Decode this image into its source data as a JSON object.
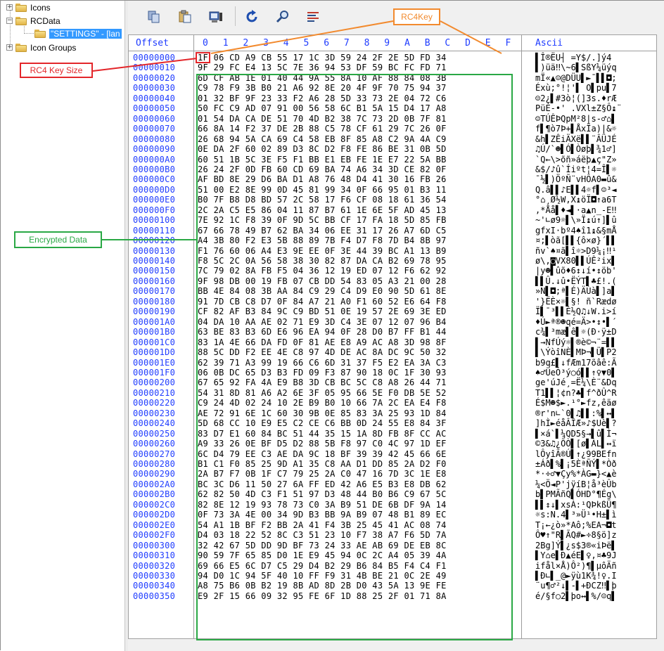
{
  "tree": {
    "items": [
      {
        "label": "Icons",
        "expander": "+"
      },
      {
        "label": "RCData",
        "expander": "−"
      },
      {
        "label": "\"SETTINGS\" - [lan"
      },
      {
        "label": "Icon Groups",
        "expander": "+"
      }
    ]
  },
  "toolbar": {
    "buttons": [
      "copy-icon",
      "paste-icon",
      "view-icon",
      "redo-icon",
      "find-icon",
      "hex-settings-icon"
    ]
  },
  "hex": {
    "offset_header": "Offset",
    "column_headers": [
      "0",
      "1",
      "2",
      "3",
      "4",
      "5",
      "6",
      "7",
      "8",
      "9",
      "A",
      "B",
      "C",
      "D",
      "E",
      "F"
    ],
    "ascii_header": "Ascii",
    "rows": [
      {
        "offset": "00000000",
        "bytes": "1F 06 CD A9 CB 55 17 1C 3D 59 24 2F 2E 5D FD 34",
        "ascii": "▌Î®ËU┤ =Y$/.]ý4"
      },
      {
        "offset": "00000010",
        "bytes": "9F 29 FC E4 13 5C 7E 36 94 53 DF 59 BC FC FD 71",
        "ascii": "▌)üä‼\\~6▌SßY¼üýq"
      },
      {
        "offset": "00000020",
        "bytes": "6D CF AB 1E 01 40 44 9A 55 8A 10 AF 88 84 08 3B",
        "ascii": "mÏ«▲☺@DÜU▌►¯▌▌◘;"
      },
      {
        "offset": "00000030",
        "bytes": "C9 78 F9 3B B0 21 A6 92 8E 20 4F 9F 70 75 94 37",
        "ascii": "Éxù;°!¦'▌ O▌pu▌7"
      },
      {
        "offset": "00000040",
        "bytes": "01 32 BF 9F 23 33 F2 A6 28 5D 33 73 2E 04 72 C6",
        "ascii": "☺2¿▌#3ò¦(]3s.♦rÆ"
      },
      {
        "offset": "00000050",
        "bytes": "50 FC C9 AD 07 91 00 56 58 6C B1 5A 15 D4 17 A8",
        "ascii": "PüÉ-•' .VXl±Z§Ô↨¨"
      },
      {
        "offset": "00000060",
        "bytes": "01 54 DA CA DE 51 70 4D B2 38 7C 73 2D 0B 7F 81",
        "ascii": "☺TÚÊÞQpM²8|s-♂⌂▌"
      },
      {
        "offset": "00000070",
        "bytes": "66 8A 14 F2 37 DE 2B 88 C5 78 CF 61 29 7C 26 0F",
        "ascii": "f▌¶ò7Þ+▌ÅxÏa)|&☼"
      },
      {
        "offset": "00000080",
        "bytes": "26 68 94 5A CA 69 C4 58 EB 8F 85 A8 C2 9A 4A C9",
        "ascii": "&h▌ZÊiÄXë▌▌¨ÂÜJÉ"
      },
      {
        "offset": "00000090",
        "bytes": "0E DA 2F 60 02 89 D3 8C D2 F8 FE 86 BE 31 0B 5D",
        "ascii": "♫Ú/`☻▌Ó▌Òøþ▌¾1♂]"
      },
      {
        "offset": "000000A0",
        "bytes": "60 51 1B 5C 3E F5 F1 BB E1 EB FE 1E E7 22 5A BB",
        "ascii": "`Q←\\>õñ»áëþ▲ç\"Z»"
      },
      {
        "offset": "000000B0",
        "bytes": "26 24 2F 0D FB 60 CD 69 BA 74 A6 34 3D CE 82 0F",
        "ascii": "&$/♪û`Íiºt¦4=Î▌☼"
      },
      {
        "offset": "000000C0",
        "bytes": "AF BD 8E 29 D6 BA D1 A8 76 48 D4 41 30 16 FB 26",
        "ascii": "¯½▌)ÖºÑ¨vHÔA0▬û&"
      },
      {
        "offset": "000000D0",
        "bytes": "51 00 E2 8E 99 0D 45 81 99 34 0F 66 95 01 B3 11",
        "ascii": "Q.â▌▌♪E▌▌4☼f▌☺³◄"
      },
      {
        "offset": "000000E0",
        "bytes": "B0 7F B8 D8 BD 57 2C 58 17 F6 CF 08 18 61 36 54",
        "ascii": "°⌂¸Ø½W,X↨öÏ◘↑a6T"
      },
      {
        "offset": "000000F0",
        "bytes": "2C 2A C5 E5 86 04 11 87 B7 61 1E 6E 5F AD 45 13",
        "ascii": ",*Åå▌♦◄▌·a▲n_-E‼"
      },
      {
        "offset": "00000100",
        "bytes": "7E 92 1C F8 39 0F 9D 5C BB CF 17 FA 18 5D 85 FB",
        "ascii": "~'∟ø9☼▌\\»Ï↨ú↑]▌û"
      },
      {
        "offset": "00000110",
        "bytes": "67 66 78 49 B7 62 BA 34 06 EE 31 17 26 A7 6D C5",
        "ascii": "gfxI·bº4♠î1↨&§mÅ"
      },
      {
        "offset": "00000120",
        "bytes": "A4 3B 80 F2 E3 5B 88 89 7B F4 D7 F8 7D B4 8B 97",
        "ascii": "¤;▌òã[▌▌{ô×ø}´▌▌"
      },
      {
        "offset": "00000130",
        "bytes": "F1 76 60 06 A4 E3 9E EE 0F 3E 44 39 BC A1 13 B9",
        "ascii": "ñv`♠¤ã▌î☼>D9¼¡‼¹"
      },
      {
        "offset": "00000140",
        "bytes": "F8 5C 2C 0A 56 58 38 30 82 87 DA CA B2 69 78 95",
        "ascii": "ø\\,◙VX80▌▌ÚÊ²ix▌"
      },
      {
        "offset": "00000150",
        "bytes": "7C 79 02 8A FB F5 04 36 12 19 ED 07 12 F6 62 92",
        "ascii": "|y☻▌ûõ♦6↕↓í•↕öb'"
      },
      {
        "offset": "00000160",
        "bytes": "9F 98 DB 00 19 FB 07 CB DD 54 83 05 A3 21 00 28",
        "ascii": "▌▌Û.↓û•ËÝT▌♣£!.("
      },
      {
        "offset": "00000170",
        "bytes": "BB 4E 84 08 3B AA 84 C9 29 C4 D9 E0 90 5D 61 8E",
        "ascii": "»N▌◘;ª▌É)ÄÙà▌]a▌"
      },
      {
        "offset": "00000180",
        "bytes": "91 7D CB C8 D7 0F 84 A7 21 A0 F1 60 52 E6 64 F8",
        "ascii": "'}ËÈ×☼▌§! ñ`Rædø"
      },
      {
        "offset": "00000190",
        "bytes": "CF 82 AF B3 84 9C C9 BD 51 0E 19 57 2E 69 3E ED",
        "ascii": "Ï▌¯³▌▌É½Q♫↓W.i>í"
      },
      {
        "offset": "000001A0",
        "bytes": "04 DA 10 AA AE 02 71 E9 3D C4 3E 07 12 07 96 B4",
        "ascii": "♦Ú►ª®☻qé=Ä>•↕•▌´"
      },
      {
        "offset": "000001B0",
        "bytes": "63 BE 83 B3 6D E6 96 EA 94 0F 28 D0 B7 FF B1 44",
        "ascii": "c¾▌³mæ▌ê▌☼(Ð·ÿ±D"
      },
      {
        "offset": "000001C0",
        "bytes": "83 1A 4E 66 DA FD 0F 81 AE E8 A9 AC A8 3D 98 8F",
        "ascii": "▌→NfÚý☼▌®è©¬¨=▌▌"
      },
      {
        "offset": "000001D0",
        "bytes": "88 5C DD F2 EE 4E C8 97 4D DE AC 8A DC 9C 50 32",
        "ascii": "▌\\ÝòîNÈ▌MÞ¬▌Ü▌P2"
      },
      {
        "offset": "000001E0",
        "bytes": "62 39 71 A3 99 19 66 C6 6D 31 37 F5 E2 EA 3A C3",
        "ascii": "b9q£▌↓fÆm17õâê:Ã"
      },
      {
        "offset": "000001F0",
        "bytes": "06 0B DC 65 D3 B3 FD 09 F3 87 90 18 0C 1F 30 93",
        "ascii": "♠♂ÜeÓ³ý○ó▌▌↑♀▼0▌"
      },
      {
        "offset": "00000200",
        "bytes": "67 65 92 FA 4A E9 B8 3D CB BC 5C C8 A8 26 44 71",
        "ascii": "ge'úJé¸=Ë¼\\È¨&Dq"
      },
      {
        "offset": "00000210",
        "bytes": "54 31 8D 81 A6 A2 6E 3F 05 95 66 5E F0 DB 5E 52",
        "ascii": "T1▌▌¦¢n?♣▌f^ðÛ^R"
      },
      {
        "offset": "00000220",
        "bytes": "C9 24 4D 02 24 10 2E B9 B0 10 66 7A 2C EA E4 F8",
        "ascii": "É$M☻$►.¹°►fz,êäø"
      },
      {
        "offset": "00000230",
        "bytes": "AE 72 91 6E 1C 60 30 9B 0E 85 83 3A 25 93 1D 84",
        "ascii": "®r'n∟`0▌♫▌▌:%▌↔▌"
      },
      {
        "offset": "00000240",
        "bytes": "5D 68 CC 10 E9 E5 C2 CE C6 BB 0D 24 55 E8 84 3F",
        "ascii": "]hÌ►éåÂÎÆ»♪$Uè▌?"
      },
      {
        "offset": "00000250",
        "bytes": "83 D7 E1 60 84 BC 51 44 35 15 1A 8D FB 8F CC AC",
        "ascii": "▌×á`▌¼QD5§→▌û▌Ì¬"
      },
      {
        "offset": "00000260",
        "bytes": "A9 33 26 0E BF D5 D2 88 5B F8 97 C0 4C 97 1D EF",
        "ascii": "©3&♫¿ÕÒ▌[ø▌ÀL▌↔ï"
      },
      {
        "offset": "00000270",
        "bytes": "6C D4 79 EE C3 AE DA 9C 18 BF 39 39 42 45 66 6E",
        "ascii": "lÔyîÃ®Ú▌↑¿99BEfn"
      },
      {
        "offset": "00000280",
        "bytes": "B1 C1 F0 85 25 9D A1 35 C8 AA D1 DD 85 2A D2 F0",
        "ascii": "±Áð▌%▌¡5ÈªÑÝ▌*Òð"
      },
      {
        "offset": "00000290",
        "bytes": "2A B7 F7 0B 1F C7 79 25 2A C0 47 16 7D 3C 1E E8",
        "ascii": "*·÷♂▼Çy%*ÀG▬}<▲è"
      },
      {
        "offset": "000002A0",
        "bytes": "BC 3C D6 11 50 27 6A FF ED 42 A6 E5 B3 E8 DB 62",
        "ascii": "¼<Ö◄P'jÿíB¦å³èÛb"
      },
      {
        "offset": "000002B0",
        "bytes": "62 82 50 4D C3 F1 51 97 D3 48 44 B0 B6 C9 67 5C",
        "ascii": "b▌PMÃñQ▌ÓHD°¶Ég\\"
      },
      {
        "offset": "000002C0",
        "bytes": "82 8E 12 19 93 78 73 C0 3A B9 51 DE 6B DF 9A 14",
        "ascii": "▌▌↕↓▌xsÀ:¹QÞkßÜ¶"
      },
      {
        "offset": "000002D0",
        "bytes": "0F 73 3A 4E 00 34 9D B3 BB 9A B9 07 48 B1 89 EC",
        "ascii": "☼s:N.4▌³»Ü¹•H±▌ì"
      },
      {
        "offset": "000002E0",
        "bytes": "54 A1 1B BF F2 BB 2A 41 F4 3B 25 45 41 AC 08 74",
        "ascii": "T¡←¿ò»*Aô;%EA¬◘t"
      },
      {
        "offset": "000002F0",
        "bytes": "D4 03 18 22 52 8C C3 51 23 10 F7 38 A7 F6 5D 7A",
        "ascii": "Ô♥↑\"R▌ÃQ#►÷8§ö]z"
      },
      {
        "offset": "00000300",
        "bytes": "32 42 67 5D DD 9D BF 73 24 33 AE AB 69 DE EB 8C",
        "ascii": "2Bg]Ý▌¿s$3®«iÞë▌"
      },
      {
        "offset": "00000310",
        "bytes": "90 59 7F 65 85 D0 1E E9 45 94 0C 2C A4 05 39 4A",
        "ascii": "▌Y⌂e▌Ð▲éE▌♀,¤♣9J"
      },
      {
        "offset": "00000320",
        "bytes": "69 66 E5 6C D7 C5 29 D4 B2 29 B6 84 B5 F4 C4 F1",
        "ascii": "ifål×Å)Ô²)¶▌µôÄñ"
      },
      {
        "offset": "00000330",
        "bytes": "94 D0 1C 94 5F 40 10 FF F9 31 4B BE 21 0C 2E 49",
        "ascii": "▌Ð∟▌_@►ÿù1K¾!♀.I"
      },
      {
        "offset": "00000340",
        "bytes": "A8 75 B6 0B B2 19 8B AD 8D 2B D0 43 5A 13 9E FE",
        "ascii": "¨u¶♂²↓▌-▌+ÐCZ‼▌þ"
      },
      {
        "offset": "00000350",
        "bytes": "E9 2F 15 66 09 32 95 FE 6F 1D 88 25 2F 01 71 8A",
        "ascii": "é/§f○2▌þo↔▌%/☺q▌"
      }
    ]
  },
  "annotations": {
    "key_size_label": "RC4 Key Size",
    "key_label": "RC4Key",
    "encrypted_label": "Encrypted Data",
    "colors": {
      "red": "#e3262a",
      "orange": "#f28a2e",
      "green": "#2aa845"
    }
  }
}
